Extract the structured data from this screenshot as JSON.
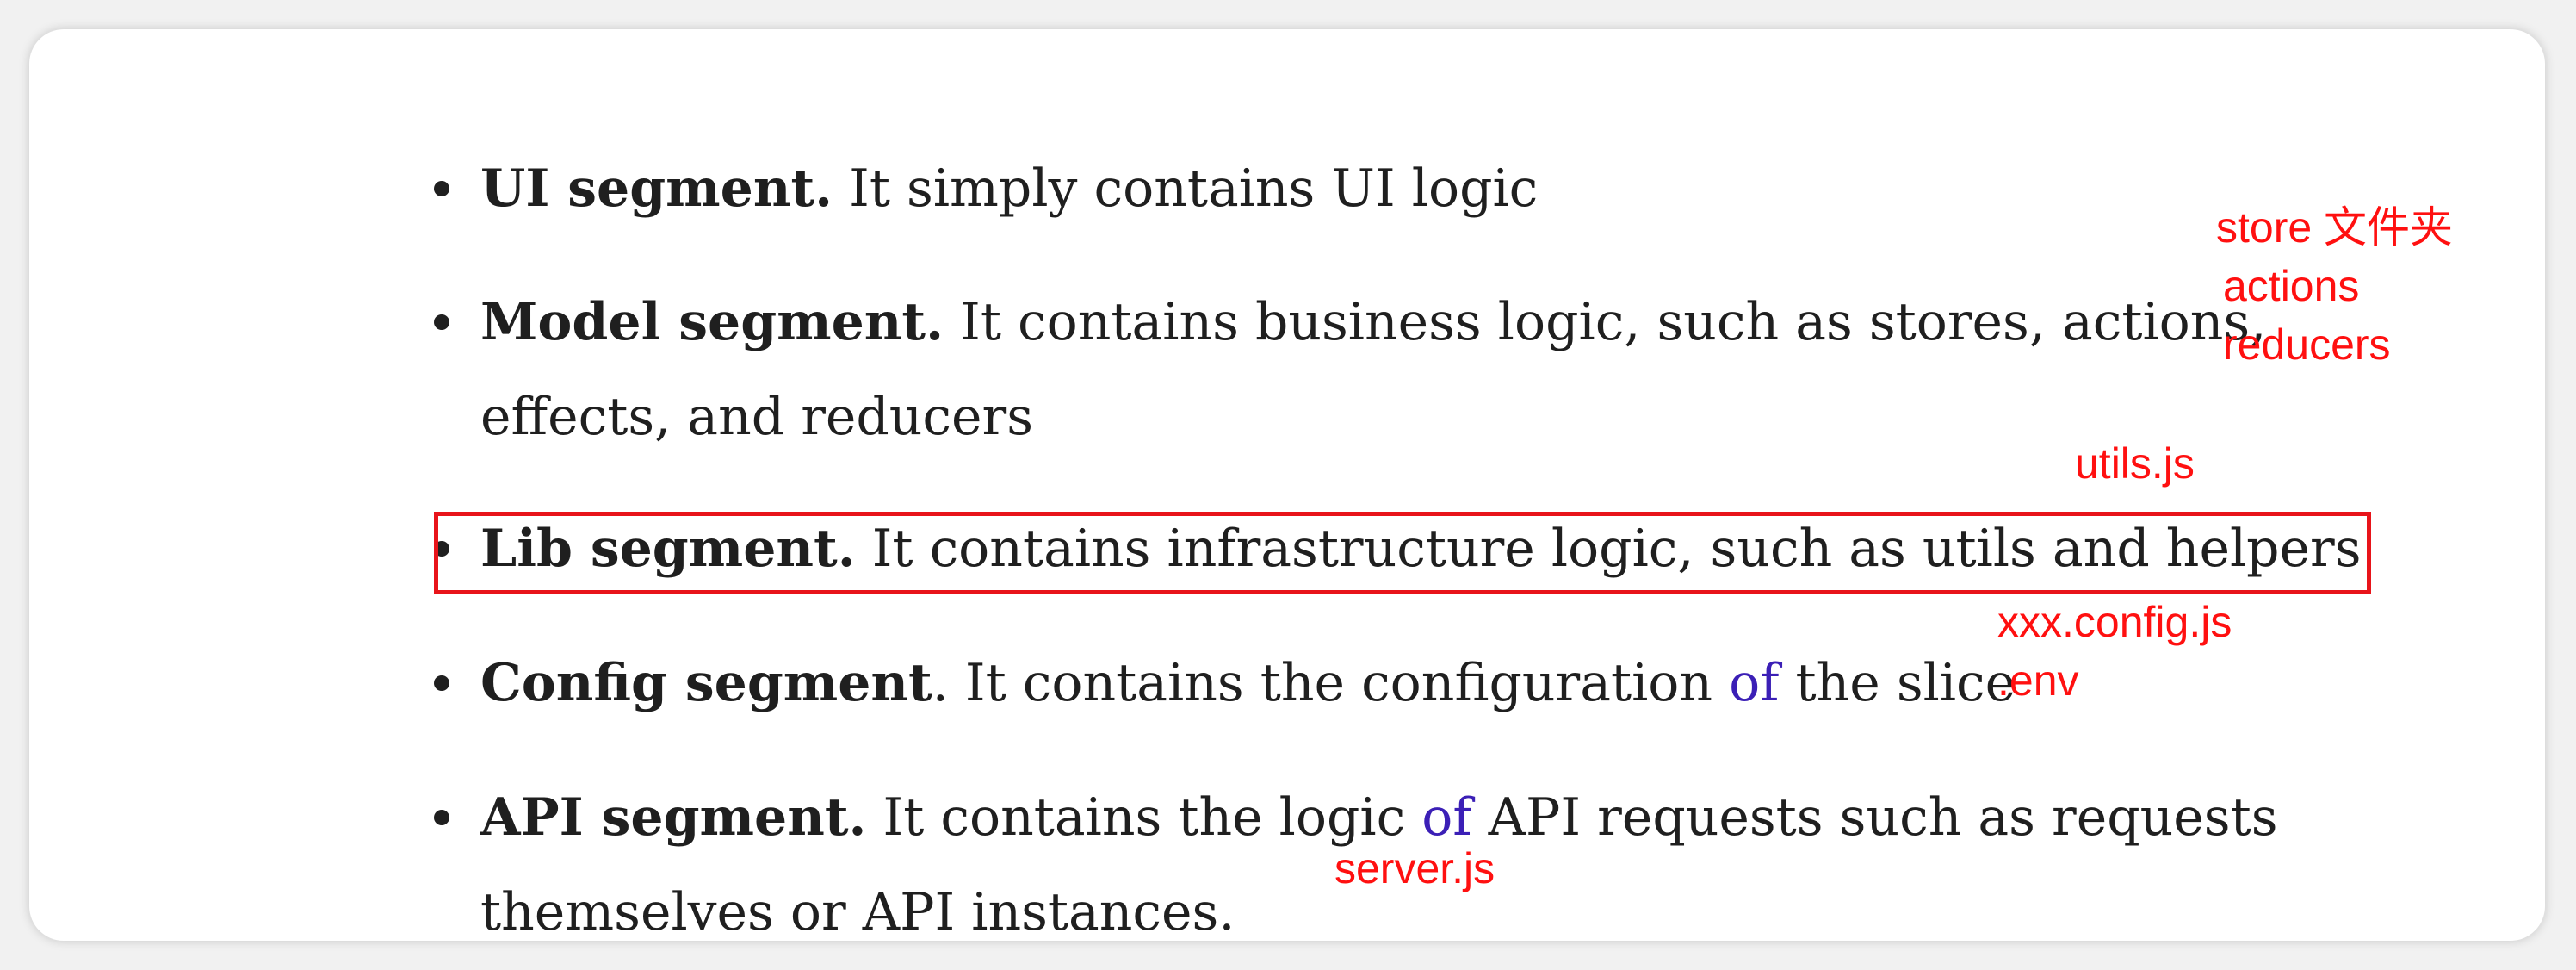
{
  "segments": [
    {
      "bold": "UI segment.",
      "line1": " It simply contains UI logic",
      "line2": ""
    },
    {
      "bold": "Model segment.",
      "line1": " It contains business logic, such as stores, actions,",
      "line2": "effects, and reducers"
    },
    {
      "bold": "Lib segment.",
      "line1": " It contains infrastructure logic, such as utils and helpers",
      "line2": ""
    },
    {
      "bold": "Config segment",
      "dot": ".",
      "pre": " It contains the configuration ",
      "of": "of",
      "post": " the slice"
    },
    {
      "bold": "API segment.",
      "pre": " It contains the logic ",
      "of": "of",
      "post": " API requests such as requests",
      "line2": "themselves or API instances."
    }
  ],
  "annotations": {
    "model": [
      "store 文件夹",
      "actions",
      "reducers"
    ],
    "lib": "utils.js",
    "config": [
      "xxx.config.js",
      ".env"
    ],
    "api": "server.js"
  },
  "colors": {
    "annotation": "#ff1010",
    "highlight_border": "#e8141a",
    "of_link": "#3b1fb6",
    "text": "#1f1f1f"
  }
}
